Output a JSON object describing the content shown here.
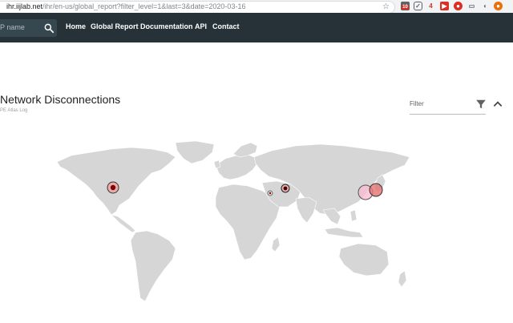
{
  "browser": {
    "url_host": "ihr.iijlab.net",
    "url_path": "/ihr/en-us/global_report?filter_level=1&last=3&date=2020-03-16",
    "extensions": [
      {
        "name": "calendar-badge-icon",
        "text": "10"
      },
      {
        "name": "pocket-icon",
        "text": ""
      },
      {
        "name": "extension-4-icon",
        "text": "4"
      },
      {
        "name": "youtube-icon",
        "text": ""
      },
      {
        "name": "record-icon",
        "text": ""
      },
      {
        "name": "cast-icon",
        "text": ""
      },
      {
        "name": "circle-icon",
        "text": ""
      },
      {
        "name": "lastpass-icon",
        "text": ""
      },
      {
        "name": "profile-icon",
        "text": ""
      }
    ]
  },
  "navbar": {
    "search_placeholder": "P name",
    "items": [
      "Home",
      "Global Report",
      "Documentation",
      "API",
      "Contact"
    ]
  },
  "page": {
    "title": "Network Disconnections",
    "subtitle": "PE Atlas Log"
  },
  "filter": {
    "label": "Filter"
  },
  "map": {
    "land_color": "#d6d6d6",
    "markers": [
      {
        "name": "marker-us-west",
        "intensity": "high"
      },
      {
        "name": "marker-egypt",
        "intensity": "low"
      },
      {
        "name": "marker-iran",
        "intensity": "high"
      },
      {
        "name": "marker-china-east",
        "intensity": "medium"
      },
      {
        "name": "marker-japan",
        "intensity": "high"
      }
    ]
  },
  "colors": {
    "navbar": "#263238",
    "marker_fill": "#e57373",
    "marker_core": "#7f0000"
  }
}
